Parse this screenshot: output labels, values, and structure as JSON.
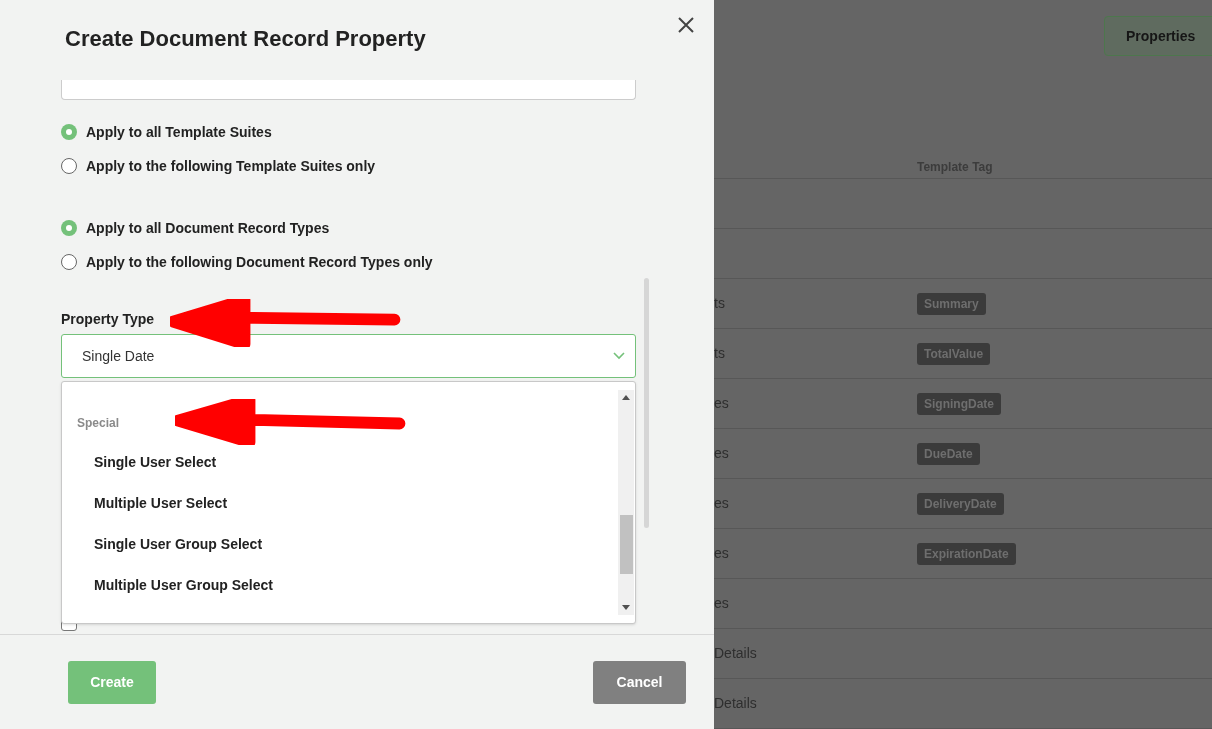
{
  "dialog": {
    "title": "Create Document Record Property",
    "scope_groups": [
      [
        {
          "label": "Apply to all Template Suites",
          "selected": true
        },
        {
          "label": "Apply to the following Template Suites only",
          "selected": false
        }
      ],
      [
        {
          "label": "Apply to all Document Record Types",
          "selected": true
        },
        {
          "label": "Apply to the following Document Record Types only",
          "selected": false
        }
      ]
    ],
    "property_type": {
      "label": "Property Type",
      "value": "Single Date"
    },
    "dropdown": {
      "group": "Special",
      "options": [
        "Single User Select",
        "Multiple User Select",
        "Single User Group Select",
        "Multiple User Group Select"
      ]
    },
    "checkbox": {
      "checked": false
    },
    "buttons": [
      {
        "label": "Create",
        "kind": "primary"
      },
      {
        "label": "Cancel",
        "kind": "secondary"
      }
    ]
  },
  "background": {
    "properties_button": "Properties",
    "column_header": "Template Tag",
    "rows": [
      {},
      {},
      {
        "cell": "ts",
        "tag": "Summary"
      },
      {
        "cell": "ts",
        "tag": "TotalValue"
      },
      {
        "cell": "es",
        "tag": "SigningDate"
      },
      {
        "cell": "es",
        "tag": "DueDate"
      },
      {
        "cell": "es",
        "tag": "DeliveryDate"
      },
      {
        "cell": "es",
        "tag": "ExpirationDate"
      },
      {
        "cell": "es"
      },
      {
        "cell": "Details"
      },
      {
        "cell": "Details"
      }
    ]
  }
}
